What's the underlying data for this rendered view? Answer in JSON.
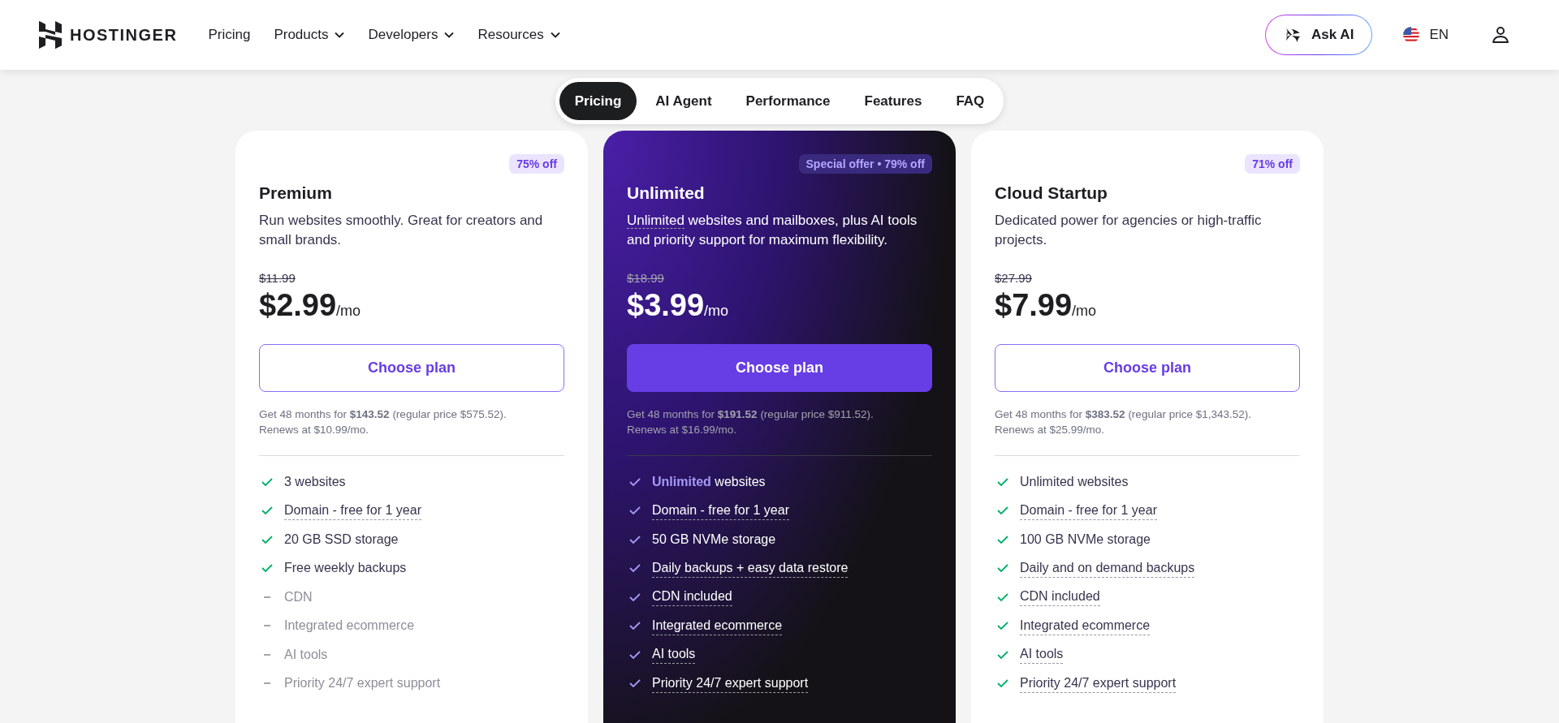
{
  "header": {
    "logo": "HOSTINGER",
    "nav": [
      {
        "label": "Pricing",
        "dropdown": false
      },
      {
        "label": "Products",
        "dropdown": true
      },
      {
        "label": "Developers",
        "dropdown": true
      },
      {
        "label": "Resources",
        "dropdown": true
      }
    ],
    "ask_ai": "Ask AI",
    "language": "EN"
  },
  "tabs": [
    {
      "label": "Pricing",
      "selected": true
    },
    {
      "label": "AI Agent",
      "selected": false
    },
    {
      "label": "Performance",
      "selected": false
    },
    {
      "label": "Features",
      "selected": false
    },
    {
      "label": "FAQ",
      "selected": false
    }
  ],
  "plans": [
    {
      "name": "Premium",
      "featured": false,
      "badge": "75% off",
      "description": "Run websites smoothly. Great for creators and small brands.",
      "old_price": "$11.99",
      "price": "$2.99",
      "per": "/mo",
      "button": "Choose plan",
      "note": "Get 48 months for **$143.52** (regular price $575.52).",
      "renews": "Renews at $10.99/mo.",
      "features": [
        {
          "text": "3 websites",
          "included": true,
          "tooltip": false
        },
        {
          "text": "Domain - free for 1 year",
          "included": true,
          "tooltip": true
        },
        {
          "text": "20 GB SSD storage",
          "included": true,
          "tooltip": false
        },
        {
          "text": "Free weekly backups",
          "included": true,
          "tooltip": false
        },
        {
          "text": "CDN",
          "included": false,
          "tooltip": false
        },
        {
          "text": "Integrated ecommerce",
          "included": false,
          "tooltip": false
        },
        {
          "text": "AI tools",
          "included": false,
          "tooltip": false
        },
        {
          "text": "Priority 24/7 expert support",
          "included": false,
          "tooltip": false
        }
      ]
    },
    {
      "name": "Unlimited",
      "featured": true,
      "badge": "Special offer • 79% off",
      "description_underlined": "Unlimited",
      "description": " websites and mailboxes, plus AI tools and priority support for maximum flexibility.",
      "old_price": "$18.99",
      "price": "$3.99",
      "per": "/mo",
      "button": "Choose plan",
      "note": "Get 48 months for **$191.52** (regular price $911.52).",
      "renews": "Renews at $16.99/mo.",
      "features": [
        {
          "text": "**Unlimited** websites",
          "included": true,
          "tooltip": false
        },
        {
          "text": "Domain - free for 1 year",
          "included": true,
          "tooltip": true
        },
        {
          "text": "50 GB NVMe storage",
          "included": true,
          "tooltip": false
        },
        {
          "text": "Daily backups + easy data restore",
          "included": true,
          "tooltip": true
        },
        {
          "text": "CDN included",
          "included": true,
          "tooltip": true
        },
        {
          "text": "Integrated ecommerce",
          "included": true,
          "tooltip": true
        },
        {
          "text": "AI tools",
          "included": true,
          "tooltip": true
        },
        {
          "text": "Priority 24/7 expert support",
          "included": true,
          "tooltip": true
        }
      ]
    },
    {
      "name": "Cloud Startup",
      "featured": false,
      "badge": "71% off",
      "description": "Dedicated power for agencies or high-traffic projects.",
      "old_price": "$27.99",
      "price": "$7.99",
      "per": "/mo",
      "button": "Choose plan",
      "note": "Get 48 months for **$383.52** (regular price $1,343.52).",
      "renews": "Renews at $25.99/mo.",
      "features": [
        {
          "text": "Unlimited websites",
          "included": true,
          "tooltip": false
        },
        {
          "text": "Domain - free for 1 year",
          "included": true,
          "tooltip": true
        },
        {
          "text": "100 GB NVMe storage",
          "included": true,
          "tooltip": false
        },
        {
          "text": "Daily and on demand backups",
          "included": true,
          "tooltip": true
        },
        {
          "text": "CDN included",
          "included": true,
          "tooltip": true
        },
        {
          "text": "Integrated ecommerce",
          "included": true,
          "tooltip": true
        },
        {
          "text": "AI tools",
          "included": true,
          "tooltip": true
        },
        {
          "text": "Priority 24/7 expert support",
          "included": true,
          "tooltip": true
        }
      ]
    }
  ]
}
